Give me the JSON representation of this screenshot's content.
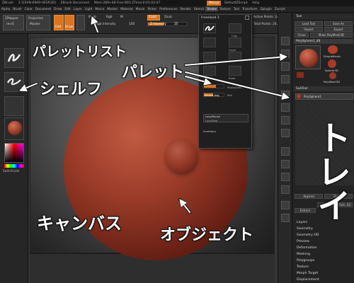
{
  "titlebar": {
    "app": "ZBrush",
    "version": "3.1[SVN-6969-HESR3D]",
    "document": "ZBrush Document",
    "memory": "Mem:289+48 Free:903 ZTime:0:01:03.07",
    "menus_btn": "Menus",
    "script_btn": "DefaultZScript",
    "help_btn": "Help"
  },
  "menubar": [
    "Alpha",
    "Brush",
    "Color",
    "Document",
    "Draw",
    "Edit",
    "Layer",
    "Light",
    "Macro",
    "Marker",
    "Material",
    "Movie",
    "Picker",
    "Preferences",
    "Render",
    "Stencil",
    "Stroke",
    "Texture",
    "Tool",
    "Transform",
    "Zplugin",
    "Zscript"
  ],
  "toolbar": {
    "zmapper": "ZMapper",
    "zmapper_sub": "rev-E",
    "projection": "Projection",
    "master": "Master",
    "edit": "Edit",
    "draw": "Draw",
    "mrgb": "Mrgb",
    "rgb": "Rgb",
    "m": "M",
    "zadd": "Zadd",
    "zsub": "Zsub",
    "rgb_intensity_label": "Rgb Intensity",
    "rgb_intensity": "100",
    "z_intensity_label": "Z Intensity",
    "z_intensity": "25",
    "stats_focal": "Focal Shift 0",
    "stats_draw": "Draw Size 64",
    "stats_points": "Active Points: 24,578",
    "stats_total": "Total Points: 24,578"
  },
  "palette": {
    "title": "FreeHand 2",
    "items": [
      "Standard",
      "Clay",
      "Inflat",
      "Layer",
      "Nudge",
      "Smooth",
      "ClayTubes",
      "Rake"
    ],
    "replace": "ReplayLast",
    "roll": "Roll",
    "mouse_avg": "Mouse Avg",
    "lazy_mouse": "LazyMouse",
    "lazy_step": "LazyStep",
    "inventory": "Inventory"
  },
  "tray": {
    "tool_title": "Tool",
    "load_tool": "Load Tool",
    "save_as": "Save As",
    "import": "Import",
    "export": "Export",
    "clone": "Clone",
    "make_poly": "Make PolyMesh3D",
    "current_tool": "PolySphere1_48",
    "thumbs": [
      "SimpleBrush",
      "Sphere3D",
      "PolyMesh3D"
    ],
    "subtool_title": "SubTool",
    "subtool_name": "PolySphere1",
    "append": "Append",
    "delete": "Delete",
    "extract": "Extract",
    "smt": "S Smt",
    "thick": "Thick .02",
    "list": [
      "Layers",
      "Geometry",
      "Geometry HD",
      "Preview",
      "Deformation",
      "Masking",
      "Polygroups",
      "Texture",
      "Morph Target",
      "Displacement"
    ]
  },
  "shelf": {
    "color_label": "SwitchColor"
  },
  "annotations": {
    "palette_list": "パレットリスト",
    "shelf": "シェルフ",
    "palette": "パレット",
    "tray": "トレイ",
    "canvas": "キャンバス",
    "object": "オブジェクト"
  },
  "colors": {
    "accent": "#d9751f",
    "sphere": "#9a3b28",
    "annotation_text": "#ffffff"
  }
}
